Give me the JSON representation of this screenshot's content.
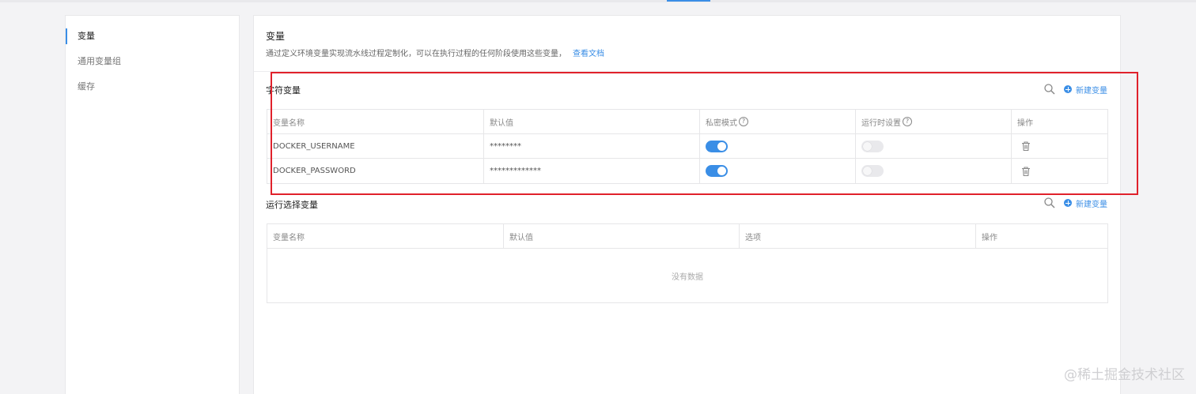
{
  "sidebar": {
    "items": [
      {
        "label": "变量",
        "active": true
      },
      {
        "label": "通用变量组",
        "active": false
      },
      {
        "label": "缓存",
        "active": false
      }
    ]
  },
  "header": {
    "title": "变量",
    "description": "通过定义环境变量实现流水线过程定制化，可以在执行过程的任何阶段使用这些变量，",
    "doc_link": "查看文档"
  },
  "string_vars": {
    "title": "字符变量",
    "add_label": "新建变量",
    "columns": [
      "变量名称",
      "默认值",
      "私密模式",
      "运行时设置",
      "操作"
    ],
    "rows": [
      {
        "name": "DOCKER_USERNAME",
        "default": "********",
        "secret": true,
        "runtime": false
      },
      {
        "name": "DOCKER_PASSWORD",
        "default": "*************",
        "secret": true,
        "runtime": false
      }
    ]
  },
  "select_vars": {
    "title": "运行选择变量",
    "add_label": "新建变量",
    "columns": [
      "变量名称",
      "默认值",
      "选项",
      "操作"
    ],
    "empty_text": "没有数据"
  },
  "watermark": "@稀土掘金技术社区",
  "colors": {
    "accent": "#3a8ee6",
    "highlight": "#e0212b"
  }
}
